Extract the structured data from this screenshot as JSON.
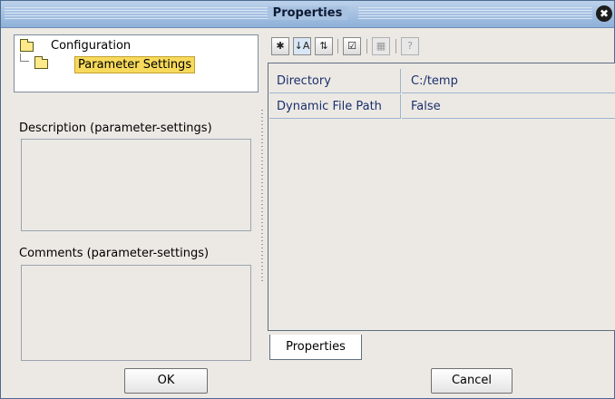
{
  "window": {
    "title": "Properties",
    "close_glyph": "✖"
  },
  "tree": {
    "root": {
      "label": "Configuration",
      "icon": "folder-icon"
    },
    "child": {
      "label": "Parameter Settings",
      "icon": "folder-icon",
      "selected": true
    }
  },
  "description": {
    "label": "Description (parameter-settings)",
    "value": ""
  },
  "comments": {
    "label": "Comments (parameter-settings)",
    "value": ""
  },
  "toolbar": {
    "buttons": [
      {
        "name": "expand-icon",
        "glyph": "✱"
      },
      {
        "name": "sort-alphabetic-icon",
        "glyph": "↓A"
      },
      {
        "name": "sort-category-icon",
        "glyph": "⇅"
      },
      {
        "name": "checklist-icon",
        "glyph": "☑"
      },
      {
        "name": "grid-view-icon",
        "glyph": "▦"
      },
      {
        "name": "help-icon",
        "glyph": "?"
      }
    ]
  },
  "properties": [
    {
      "key": "Directory",
      "value": "C:/temp"
    },
    {
      "key": "Dynamic File Path",
      "value": "False"
    }
  ],
  "tabs": [
    {
      "label": "Properties"
    }
  ],
  "buttons": {
    "ok": "OK",
    "cancel": "Cancel"
  }
}
